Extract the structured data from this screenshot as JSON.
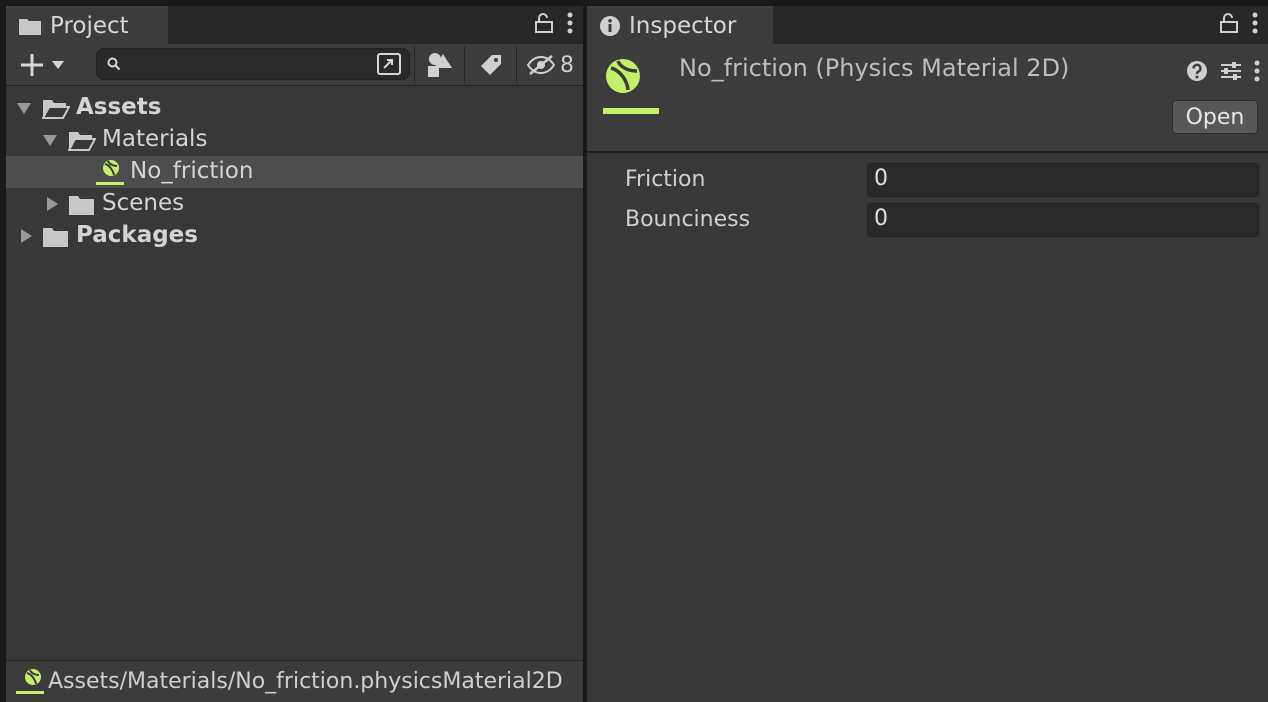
{
  "colors": {
    "accent_green": "#c3f06b"
  },
  "project": {
    "tab_label": "Project",
    "search": {
      "value": "",
      "placeholder": ""
    },
    "hidden_count": "8",
    "tree": [
      {
        "label": "Assets",
        "depth": 0,
        "expanded": true,
        "bold": true,
        "icon": "folder-open-icon"
      },
      {
        "label": "Materials",
        "depth": 1,
        "expanded": true,
        "bold": false,
        "icon": "folder-open-icon"
      },
      {
        "label": "No_friction",
        "depth": 2,
        "bold": false,
        "selected": true,
        "icon": "physics-material-icon"
      },
      {
        "label": "Scenes",
        "depth": 1,
        "expanded": false,
        "bold": false,
        "icon": "folder-icon"
      },
      {
        "label": "Packages",
        "depth": 0,
        "expanded": false,
        "bold": true,
        "icon": "folder-icon"
      }
    ],
    "status_path": "Assets/Materials/No_friction.physicsMaterial2D"
  },
  "inspector": {
    "tab_label": "Inspector",
    "title": "No_friction (Physics Material 2D)",
    "open_label": "Open",
    "properties": [
      {
        "label": "Friction",
        "value": "0"
      },
      {
        "label": "Bounciness",
        "value": "0"
      }
    ]
  }
}
